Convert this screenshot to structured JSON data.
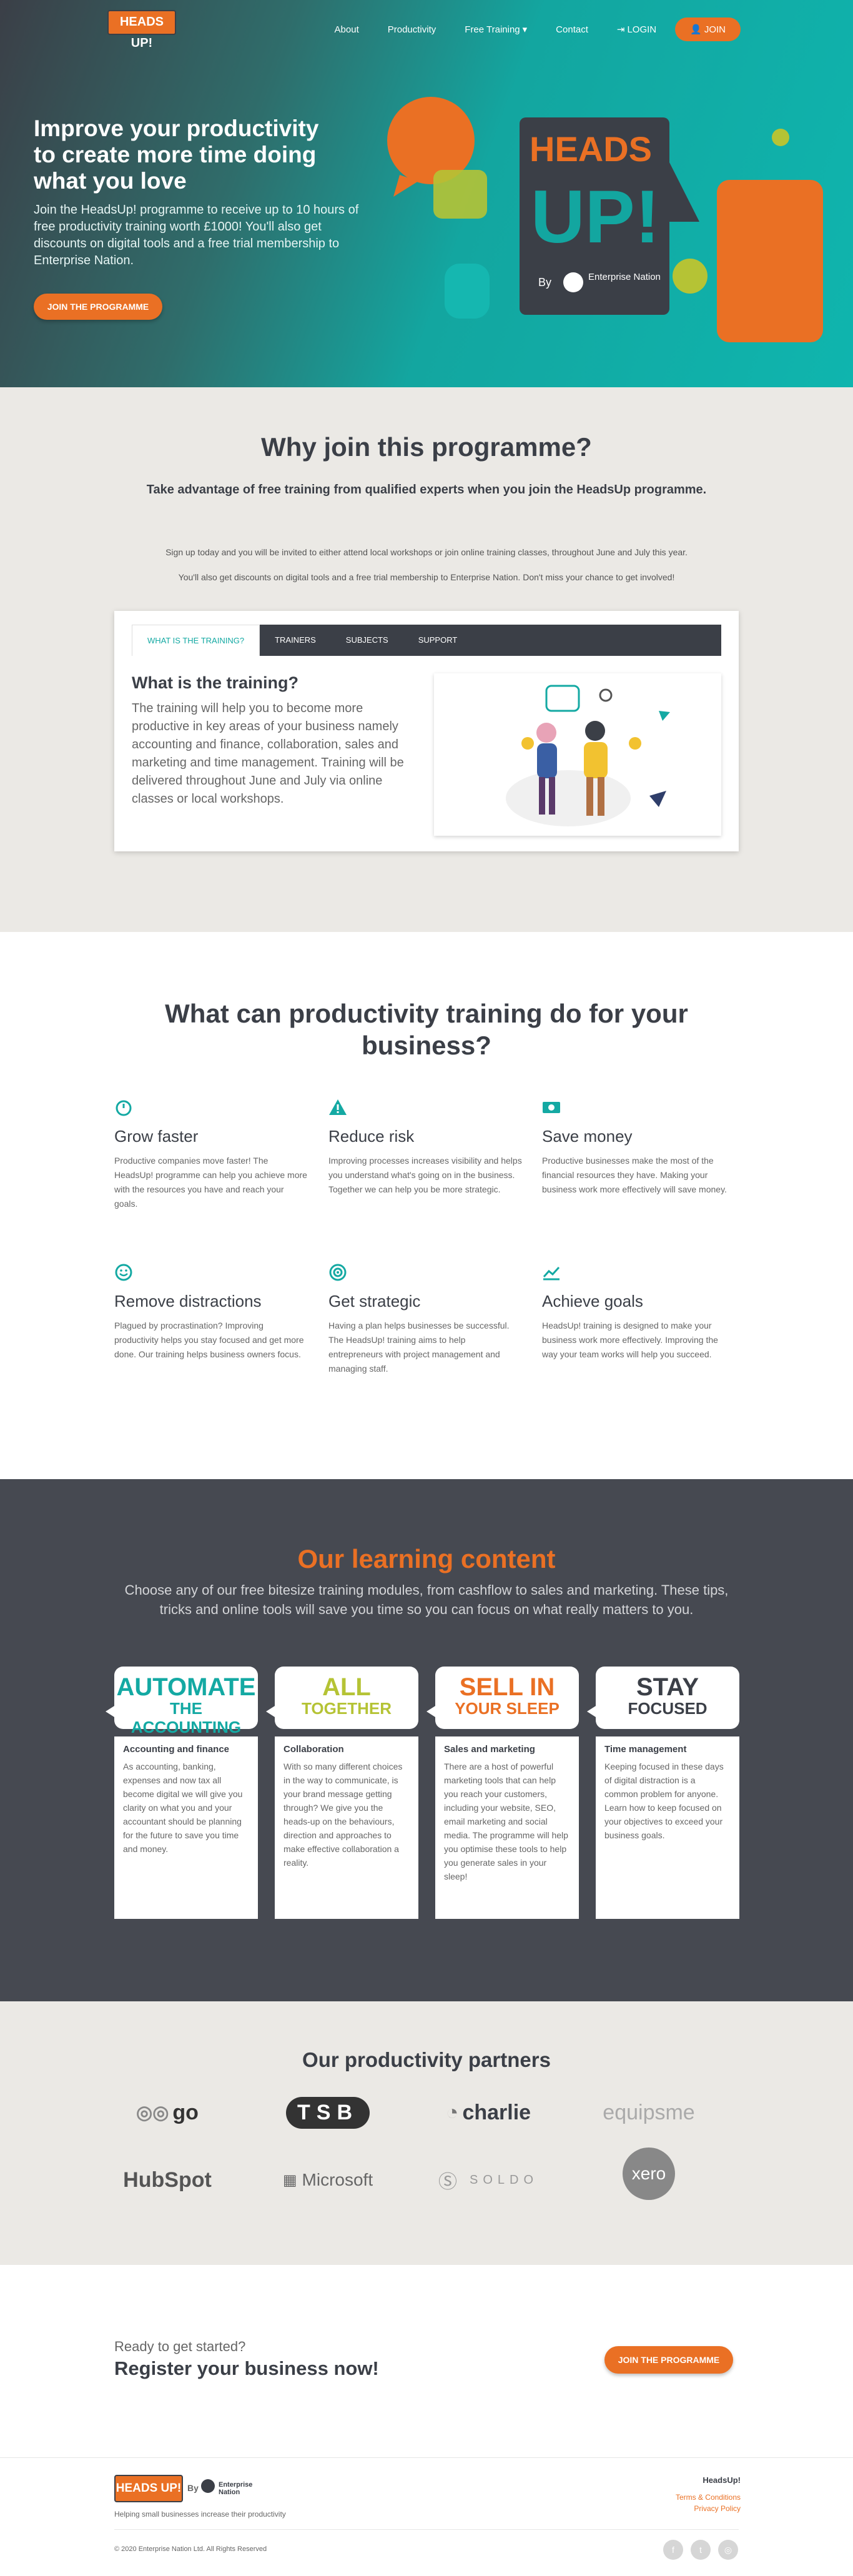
{
  "nav": {
    "logo": "HEADS UP!",
    "items": [
      "About",
      "Productivity",
      "Free Training",
      "Contact"
    ],
    "login": "LOGIN",
    "join": "JOIN"
  },
  "hero": {
    "title_line1": "Improve your productivity",
    "title_line2": "to create more time doing what you love",
    "subtitle": "Join the HeadsUp! programme to receive up to 10 hours of free productivity training worth £1000! You'll also get discounts on digital tools and a free trial membership to Enterprise Nation.",
    "cta": "JOIN THE PROGRAMME",
    "badge_top": "HEADS",
    "badge_bottom": "UP!",
    "badge_by": "By",
    "badge_partner": "Enterprise Nation"
  },
  "why": {
    "heading": "Why join this programme?",
    "subheading": "Take advantage of free training from qualified experts when you join the HeadsUp programme.",
    "para1": "Sign up today and you will be invited to either attend local workshops or join online training classes, throughout June and July this year.",
    "para2": "You'll also get discounts on digital tools and a free trial membership to Enterprise Nation. Don't miss your chance to get involved!",
    "tabs": [
      "WHAT IS THE TRAINING?",
      "TRAINERS",
      "SUBJECTS",
      "SUPPORT"
    ],
    "training_heading": "What is the training?",
    "training_text": "The training will help you to become more productive in key areas of your business namely accounting and finance, collaboration, sales and marketing and time management. Training will be delivered throughout June and July via online classes or local workshops."
  },
  "productivity": {
    "heading": "What can productivity training do for your business?",
    "features": [
      {
        "icon": "stopwatch-icon",
        "title": "Grow faster",
        "text": "Productive companies move faster! The HeadsUp! programme can help you achieve more with the resources you have and reach your goals."
      },
      {
        "icon": "warning-icon",
        "title": "Reduce risk",
        "text": "Improving processes increases visibility and helps you understand what's going on in the business. Together we can help you be more strategic."
      },
      {
        "icon": "money-icon",
        "title": "Save money",
        "text": "Productive businesses make the most of the financial resources they have. Making your business work more effectively will save money."
      },
      {
        "icon": "smile-icon",
        "title": "Remove distractions",
        "text": "Plagued by procrastination? Improving productivity helps you stay focused and get more done. Our training helps business owners focus."
      },
      {
        "icon": "target-icon",
        "title": "Get strategic",
        "text": "Having a plan helps businesses be successful. The HeadsUp! training aims to help entrepreneurs with project management and managing staff."
      },
      {
        "icon": "chart-up-icon",
        "title": "Achieve goals",
        "text": "HeadsUp! training is designed to make your business work more effectively. Improving the way your team works will help you succeed."
      }
    ]
  },
  "learning": {
    "heading": "Our learning content",
    "intro": "Choose any of our free bitesize training modules, from cashflow to sales and marketing. These tips, tricks and online tools will save you time so you can focus on what really matters to you.",
    "cards": [
      {
        "badge_big": "AUTOMATE",
        "badge_small": "THE ACCOUNTING",
        "color": "#14a9a3",
        "title": "Accounting and finance",
        "text": "As accounting, banking, expenses and now tax all become digital we will give you clarity on what you and your accountant should be planning for the future to save you time and money."
      },
      {
        "badge_big": "ALL",
        "badge_small": "TOGETHER",
        "color": "#b5c335",
        "title": "Collaboration",
        "text": "With so many different choices in the way to communicate, is your brand message getting through? We give you the heads-up on the behaviours, direction and approaches to make effective collaboration a reality."
      },
      {
        "badge_big": "SELL IN",
        "badge_small": "YOUR SLEEP",
        "color": "#ea7024",
        "title": "Sales and marketing",
        "text": "There are a host of powerful marketing tools that can help you reach your customers, including your website, SEO, email marketing and social media. The programme will help you optimise these tools to help you generate sales in your sleep!"
      },
      {
        "badge_big": "STAY",
        "badge_small": "FOCUSED",
        "color": "#3b3f47",
        "title": "Time management",
        "text": "Keeping focused in these days of digital distraction is a common problem for anyone. Learn how to keep focused on your objectives to exceed your business goals."
      }
    ]
  },
  "partners": {
    "heading": "Our productivity partners",
    "logos": [
      "go",
      "TSB",
      "charlie",
      "equipsme",
      "HubSpot",
      "Microsoft",
      "SOLDO",
      "xero"
    ]
  },
  "cta": {
    "small": "Ready to get started?",
    "big": "Register your business now!",
    "button": "JOIN THE PROGRAMME"
  },
  "footer": {
    "logo": "HEADS UP!",
    "by": "By",
    "partner": "Enterprise Nation",
    "tagline": "Helping small businesses increase their productivity",
    "heading": "HeadsUp!",
    "links": [
      "Terms & Conditions",
      "Privacy Policy"
    ],
    "copyright": "© 2020 Enterprise Nation Ltd. All Rights Reserved"
  }
}
